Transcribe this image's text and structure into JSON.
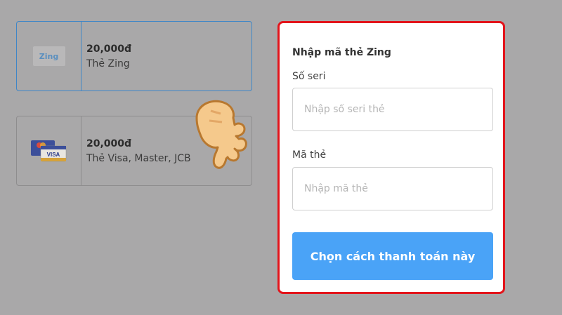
{
  "cards": [
    {
      "price": "20,000đ",
      "name": "Thẻ Zing",
      "logo_text": "Zing",
      "icon": "zing-logo"
    },
    {
      "price": "20,000đ",
      "name": "Thẻ Visa, Master, JCB",
      "logo_text": "VISA",
      "icon": "credit-card-icon"
    }
  ],
  "form": {
    "title": "Nhập mã thẻ Zing",
    "serial_label": "Số seri",
    "serial_placeholder": "Nhập số seri thẻ",
    "code_label": "Mã thẻ",
    "code_placeholder": "Nhập mã thẻ",
    "submit_label": "Chọn cách thanh toán này"
  },
  "colors": {
    "highlight": "#e3141b",
    "button": "#4aa3f7",
    "selected_border": "#3f86c7"
  },
  "pointer": {
    "icon": "pointing-hand-icon"
  }
}
